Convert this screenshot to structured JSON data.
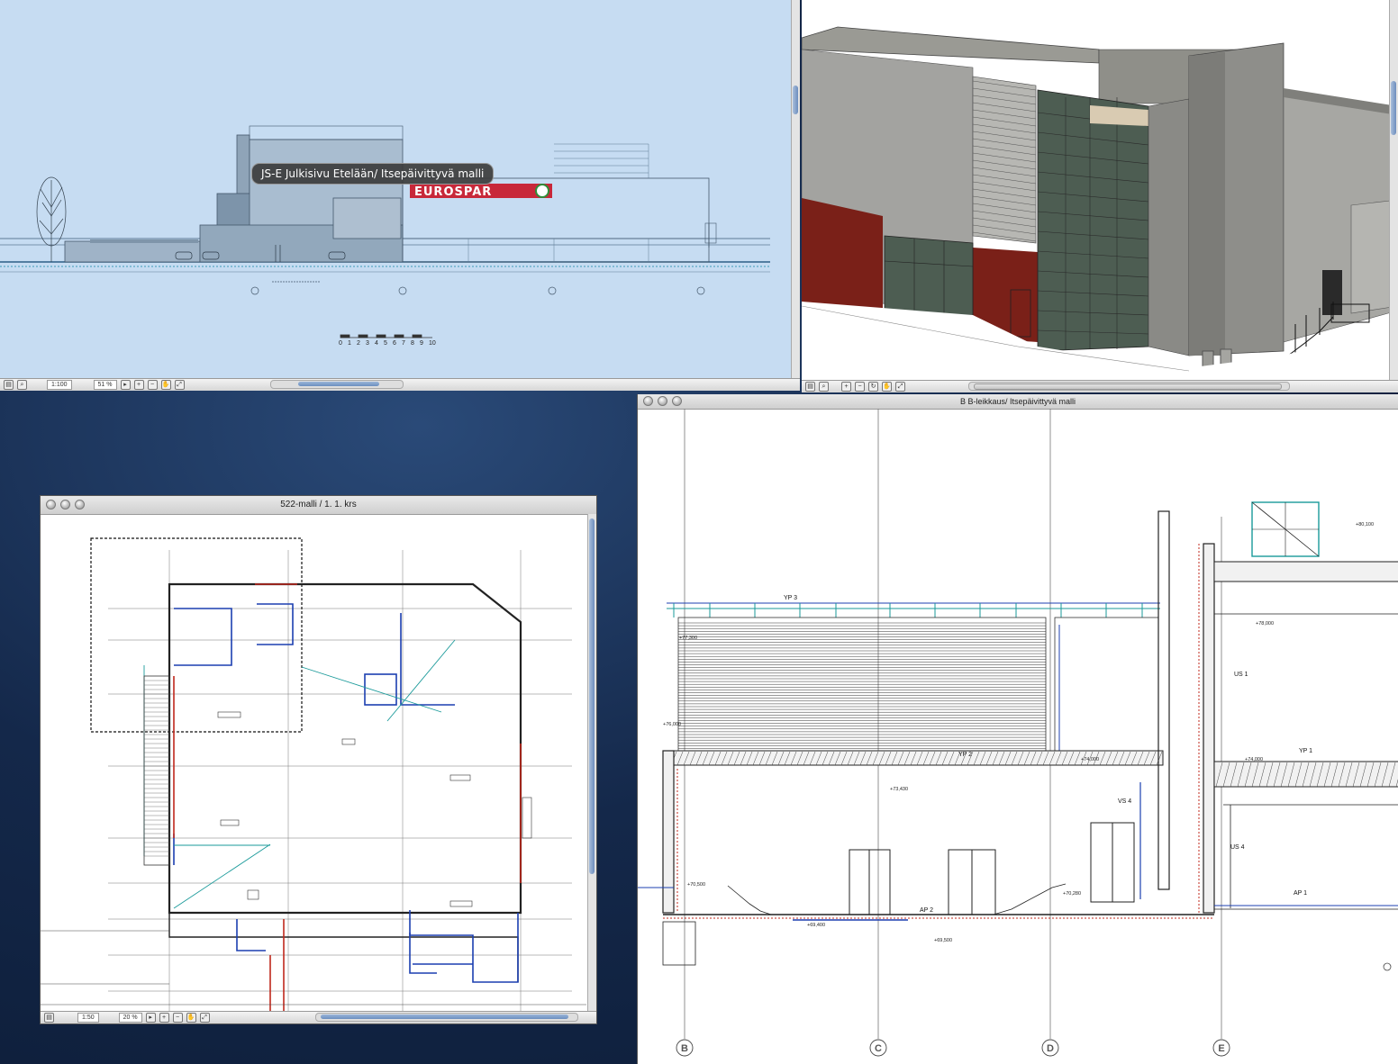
{
  "elevation_window": {
    "tooltip": "JS-E Julkisivu Etelään/ Itsepäivittyvä malli",
    "sign_text": "EUROSPAR",
    "scale_bar_labels": [
      "0",
      "1",
      "2",
      "3",
      "4",
      "5",
      "6",
      "7",
      "8",
      "9",
      "10"
    ],
    "status": {
      "scale": "1:100",
      "zoom": "51 %"
    }
  },
  "model3d_window": {},
  "plan_window": {
    "title": "522-malli / 1. 1. krs",
    "status": {
      "scale": "1:50",
      "zoom": "20 %"
    }
  },
  "section_window": {
    "title": "B B-leikkaus/ Itsepäivittyvä malli",
    "grid_labels": [
      "B",
      "C",
      "D",
      "E"
    ],
    "annotations": {
      "yp3": "YP 3",
      "yp2": "YP 2",
      "yp1": "YP 1",
      "us1": "US 1",
      "us4": "US 4",
      "vs4": "VS 4",
      "ap2": "AP 2",
      "ap1": "AP 1",
      "lvl_80100": "+80,100",
      "lvl_78000": "+78,000",
      "lvl_77300": "+77,300",
      "lvl_76000": "+76,000",
      "lvl_74000a": "+74,000",
      "lvl_74000b": "+74,000",
      "lvl_73430": "+73,430",
      "lvl_70500": "+70,500",
      "lvl_70280": "+70,280",
      "lvl_69400": "+69,400",
      "lvl_69500": "+69,500"
    }
  },
  "colors": {
    "elevation_bg": "#c6dcf2",
    "facade_red": "#7a2018",
    "glass_green": "#4d5d52",
    "sign_red": "#c8283a",
    "drawing_blue": "#1c3fb0",
    "drawing_red": "#c0281c"
  }
}
